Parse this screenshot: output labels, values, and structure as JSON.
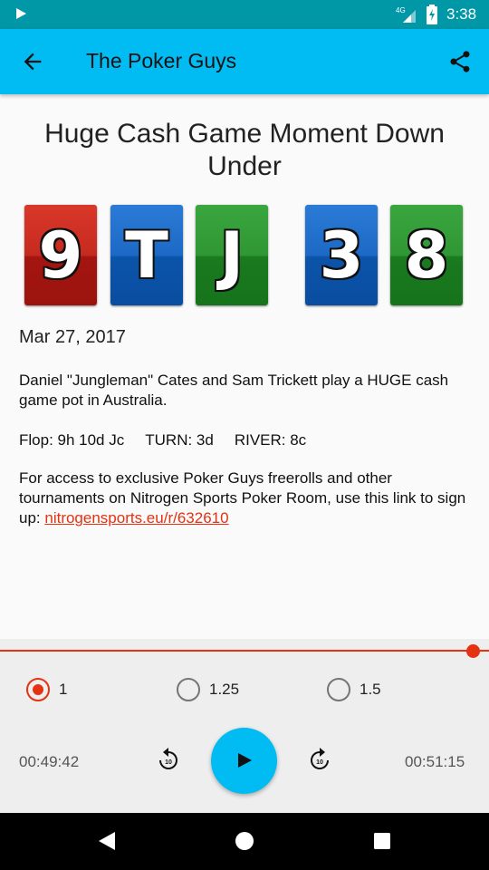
{
  "status_bar": {
    "time": "3:38",
    "network": "4G",
    "icons": [
      "play-notification-icon",
      "signal-icon",
      "battery-icon"
    ]
  },
  "app_bar": {
    "title": "The Poker Guys",
    "back_icon": "arrow-back-icon",
    "share_icon": "share-icon",
    "color": "#00bcf2"
  },
  "episode": {
    "title": "Huge Cash Game Moment Down Under",
    "cards": [
      {
        "rank": "9",
        "color": "red"
      },
      {
        "rank": "T",
        "color": "blue"
      },
      {
        "rank": "J",
        "color": "green"
      },
      {
        "rank": "3",
        "color": "blue"
      },
      {
        "rank": "8",
        "color": "green"
      }
    ],
    "date": "Mar 27, 2017",
    "description": "Daniel \"Jungleman\" Cates and Sam Trickett play a HUGE cash game pot in Australia.",
    "flop": "Flop: 9h 10d Jc",
    "turn": "TURN: 3d",
    "river": "RIVER: 8c",
    "promo_text": "For access to exclusive Poker Guys freerolls and other tournaments on Nitrogen Sports Poker Room, use this link to sign up: ",
    "promo_link": "nitrogensports.eu/r/632610"
  },
  "player": {
    "progress": 0.97,
    "speeds": [
      {
        "label": "1",
        "selected": true
      },
      {
        "label": "1.25",
        "selected": false
      },
      {
        "label": "1.5",
        "selected": false
      }
    ],
    "elapsed": "00:49:42",
    "duration": "00:51:15",
    "rewind_seconds": "10",
    "forward_seconds": "10",
    "accent": "#e53212"
  },
  "nav_bar": {
    "icons": [
      "nav-back-icon",
      "nav-home-icon",
      "nav-recents-icon"
    ]
  }
}
